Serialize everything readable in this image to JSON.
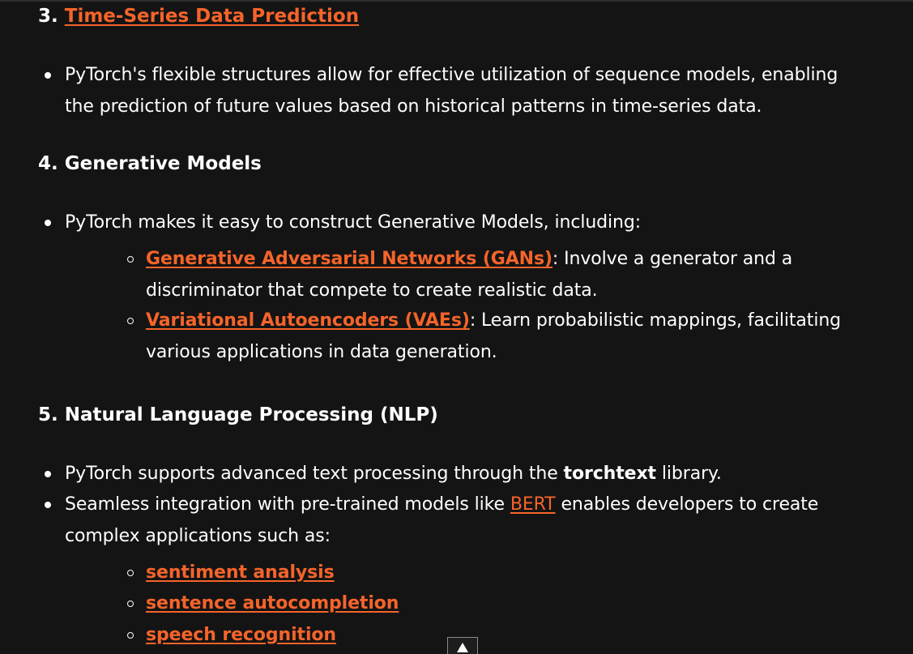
{
  "sections": {
    "time_series": {
      "number": "3.",
      "title": "Time-Series Data Prediction",
      "bullet": "PyTorch's flexible structures allow for effective utilization of sequence models, enabling the prediction of future values based on historical patterns in time-series data."
    },
    "generative": {
      "heading": "4. Generative Models",
      "bullet": "PyTorch makes it easy to construct Generative Models, including:",
      "items": [
        {
          "link": "Generative Adversarial Networks (GANs)",
          "text": ": Involve a generator and a discriminator that compete to create realistic data."
        },
        {
          "link": "Variational Autoencoders (VAEs)",
          "text": ": Learn probabilistic mappings, facilitating various applications in data generation."
        }
      ]
    },
    "nlp": {
      "heading": "5. Natural Language Processing (NLP)",
      "bullet1_before": "PyTorch supports advanced text processing through the ",
      "bullet1_bold": "torchtext",
      "bullet1_after": " library.",
      "bullet2_before": "Seamless integration with pre-trained models like ",
      "bullet2_link": "BERT",
      "bullet2_after": " enables developers to create complex applications such as:",
      "applications": [
        "sentiment analysis",
        "sentence autocompletion",
        "speech recognition"
      ]
    }
  },
  "scroll_top_icon": "arrow-up-icon",
  "colors": {
    "background": "#141414",
    "text": "#ffffff",
    "link": "#f5642a"
  }
}
